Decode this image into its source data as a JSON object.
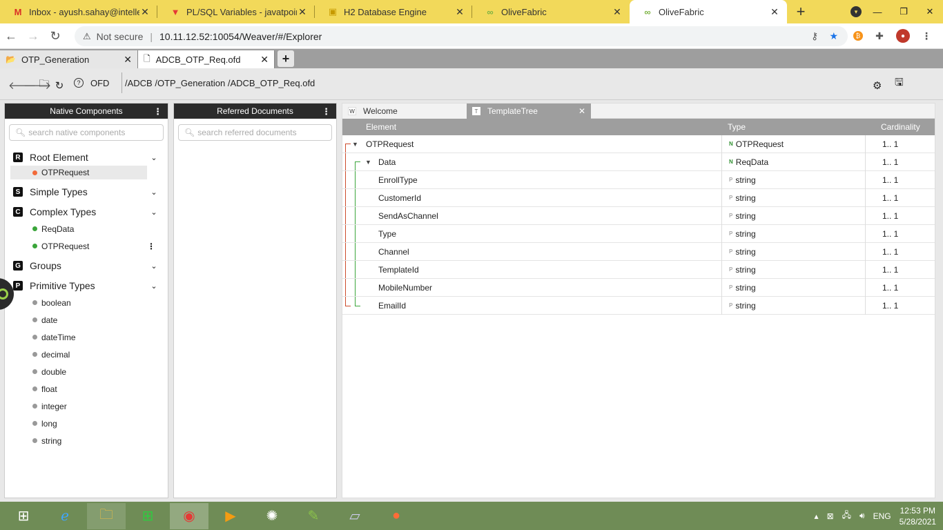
{
  "browser": {
    "tabs": [
      {
        "title": "Inbox - ayush.sahay@intellect",
        "icon": "M",
        "icon_color": "#d93025"
      },
      {
        "title": "PL/SQL Variables - javatpoint",
        "icon": "▼",
        "icon_color": "#e53935"
      },
      {
        "title": "H2 Database Engine",
        "icon": "▣",
        "icon_color": "#f2b800"
      },
      {
        "title": "OliveFabric",
        "icon": "∞",
        "icon_color": "#7cb342"
      },
      {
        "title": "OliveFabric",
        "icon": "∞",
        "icon_color": "#7cb342",
        "active": true
      }
    ],
    "not_secure_label": "Not secure",
    "url": "10.11.12.52:10054/Weaver/#/Explorer"
  },
  "app_tabs": [
    {
      "label": "OTP_Generation",
      "icon": "folder-open-icon"
    },
    {
      "label": "ADCB_OTP_Req.ofd",
      "icon": "file-icon"
    }
  ],
  "toolbar": {
    "context": "OFD",
    "path": "/ADCB /OTP_Generation /ADCB_OTP_Req.ofd"
  },
  "native_panel": {
    "title": "Native Components",
    "search_placeholder": "search native components",
    "sections": {
      "root": {
        "badge": "R",
        "title": "Root Element",
        "items": [
          "OTPRequest"
        ]
      },
      "simple": {
        "badge": "S",
        "title": "Simple Types"
      },
      "complex": {
        "badge": "C",
        "title": "Complex Types",
        "items": [
          "ReqData",
          "OTPRequest"
        ]
      },
      "groups": {
        "badge": "G",
        "title": "Groups"
      },
      "primitive": {
        "badge": "P",
        "title": "Primitive Types",
        "items": [
          "boolean",
          "date",
          "dateTime",
          "decimal",
          "double",
          "float",
          "integer",
          "long",
          "string"
        ]
      }
    }
  },
  "referred_panel": {
    "title": "Referred Documents",
    "search_placeholder": "search referred documents"
  },
  "editor": {
    "tabs": [
      {
        "letter": "W",
        "label": "Welcome"
      },
      {
        "letter": "T",
        "label": "TemplateTree"
      }
    ],
    "columns": {
      "element": "Element",
      "type": "Type",
      "cardinality": "Cardinality"
    },
    "rows": [
      {
        "name": "OTPRequest",
        "type_kind": "N",
        "type": "OTPRequest",
        "cardinality": "1.. 1"
      },
      {
        "name": "Data",
        "type_kind": "N",
        "type": "ReqData",
        "cardinality": "1.. 1"
      },
      {
        "name": "EnrollType",
        "type_kind": "P",
        "type": "string",
        "cardinality": "1.. 1"
      },
      {
        "name": "CustomerId",
        "type_kind": "P",
        "type": "string",
        "cardinality": "1.. 1"
      },
      {
        "name": "SendAsChannel",
        "type_kind": "P",
        "type": "string",
        "cardinality": "1.. 1"
      },
      {
        "name": "Type",
        "type_kind": "P",
        "type": "string",
        "cardinality": "1.. 1"
      },
      {
        "name": "Channel",
        "type_kind": "P",
        "type": "string",
        "cardinality": "1.. 1"
      },
      {
        "name": "TemplateId",
        "type_kind": "P",
        "type": "string",
        "cardinality": "1.. 1"
      },
      {
        "name": "MobileNumber",
        "type_kind": "P",
        "type": "string",
        "cardinality": "1.. 1"
      },
      {
        "name": "EmailId",
        "type_kind": "P",
        "type": "string",
        "cardinality": "1.. 1"
      }
    ]
  },
  "taskbar": {
    "lang": "ENG",
    "time": "12:53 PM",
    "date": "5/28/2021"
  }
}
